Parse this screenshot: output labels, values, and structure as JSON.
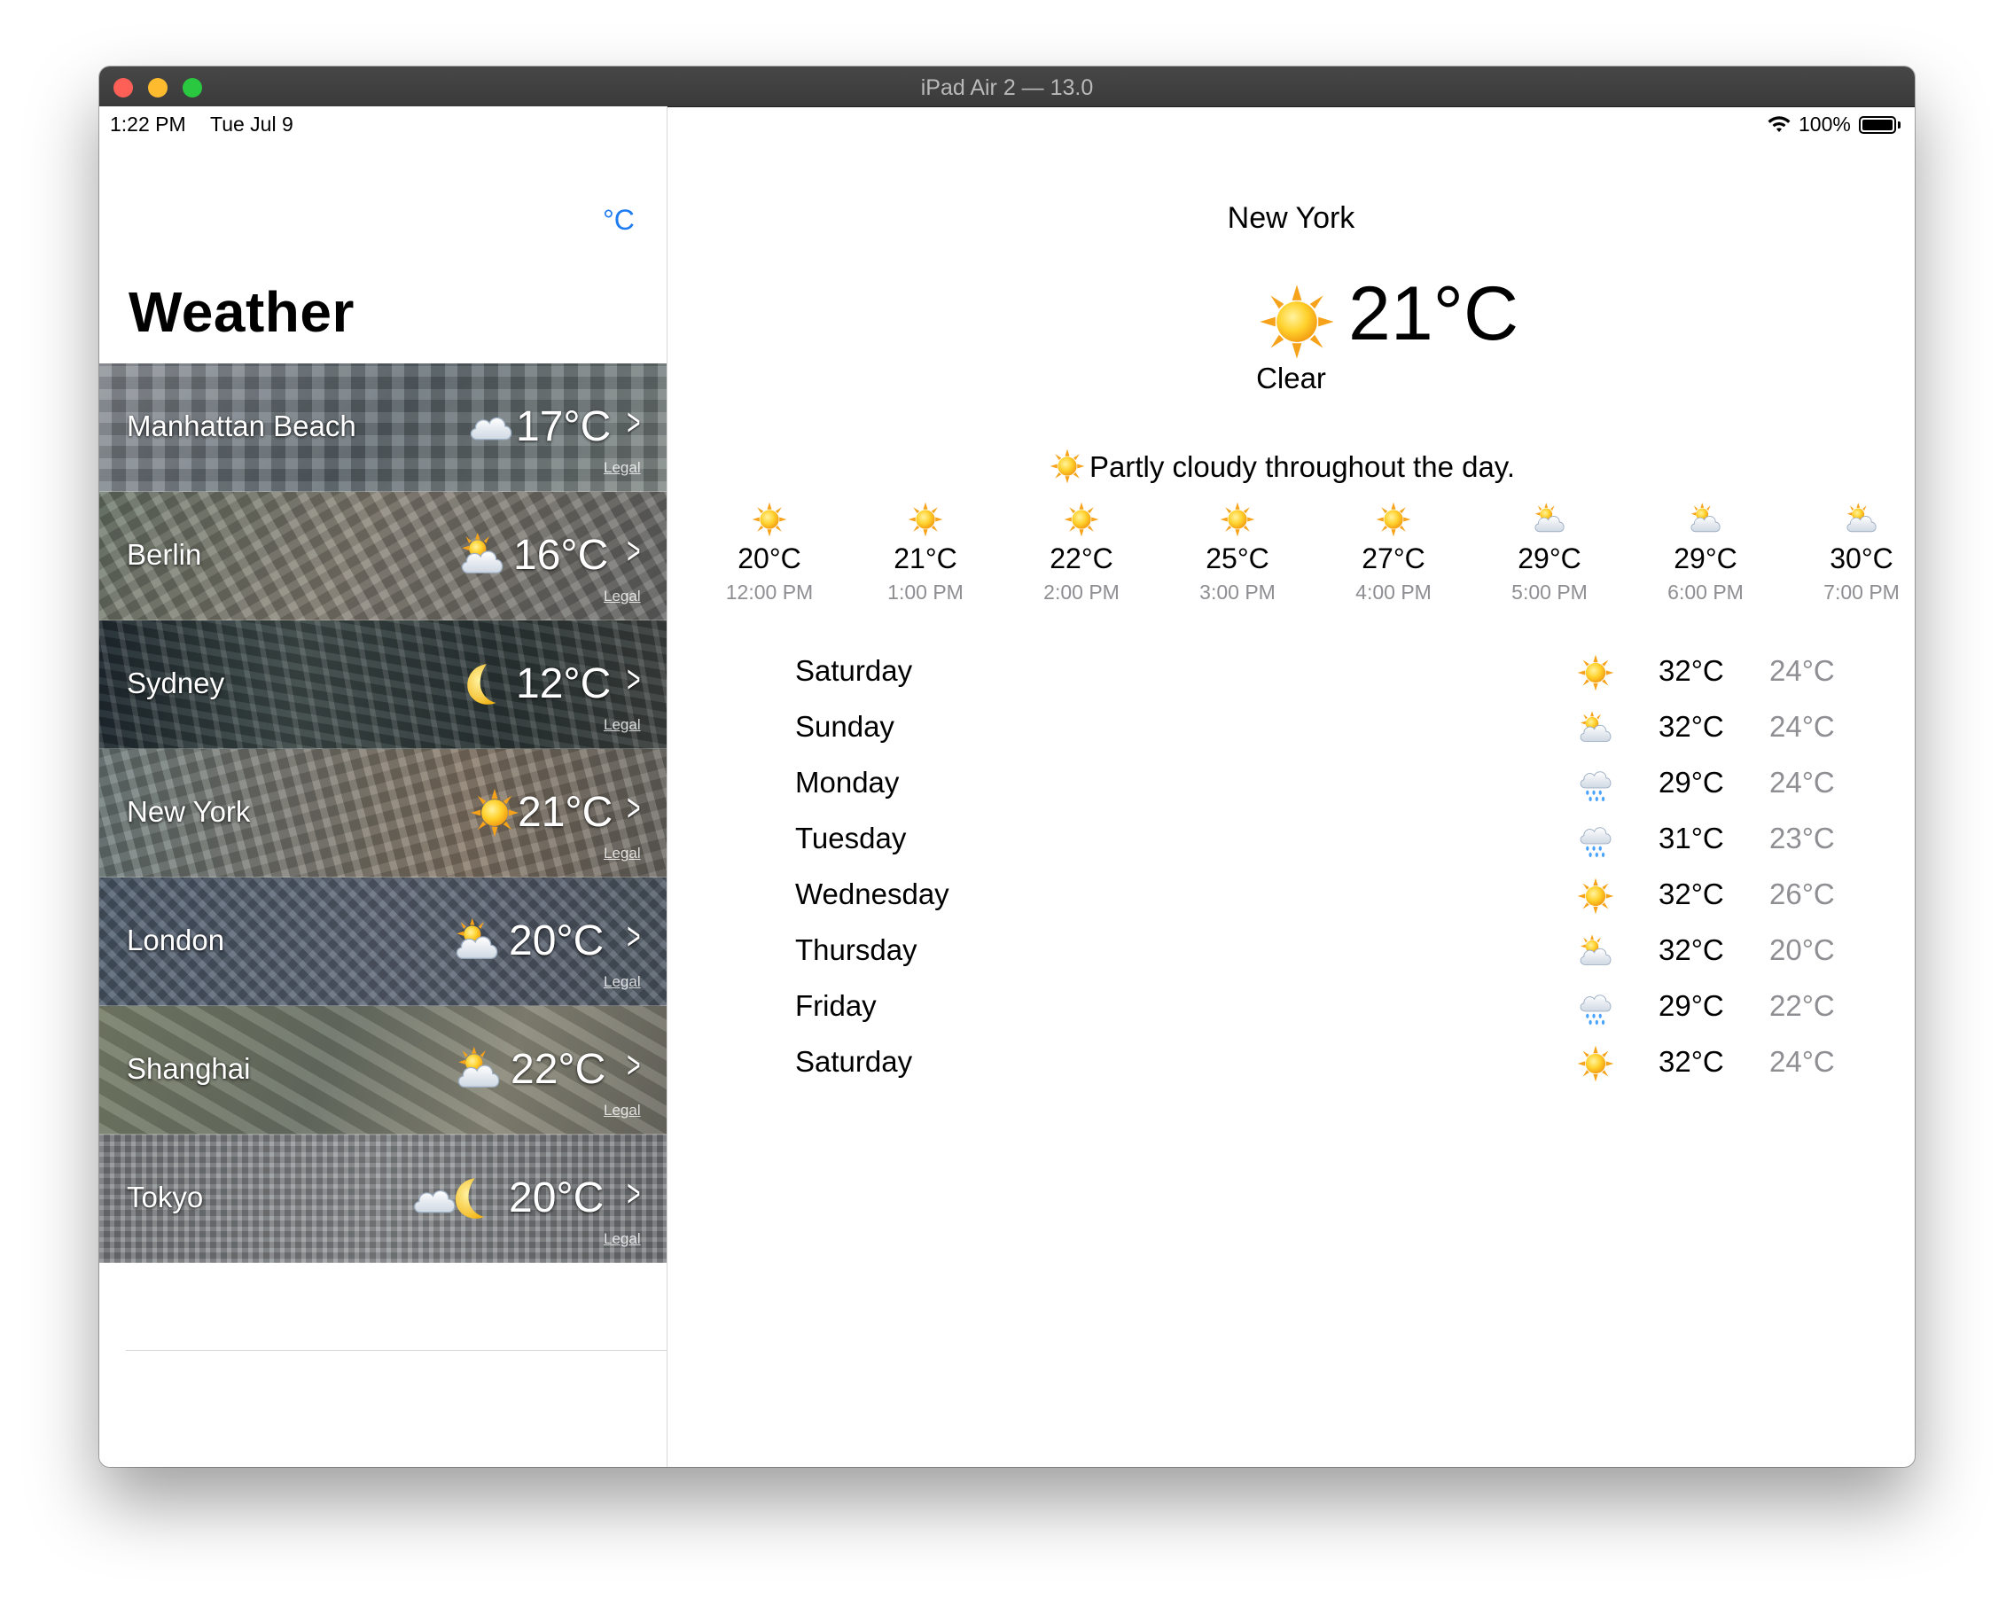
{
  "window": {
    "title": "iPad Air 2 — 13.0"
  },
  "status_bar": {
    "time": "1:22 PM",
    "date": "Tue Jul 9",
    "battery": "100%"
  },
  "sidebar": {
    "unit_toggle": "°C",
    "title": "Weather",
    "cities": [
      {
        "name": "Manhattan Beach",
        "temp": "17°C",
        "icon": "cloud-icon",
        "legal": "Legal"
      },
      {
        "name": "Berlin",
        "temp": "16°C",
        "icon": "sun-behind-cloud-icon",
        "legal": "Legal"
      },
      {
        "name": "Sydney",
        "temp": "12°C",
        "icon": "moon-icon",
        "legal": "Legal"
      },
      {
        "name": "New York",
        "temp": "21°C",
        "icon": "sun-icon",
        "legal": "Legal"
      },
      {
        "name": "London",
        "temp": "20°C",
        "icon": "sun-behind-cloud-icon",
        "legal": "Legal"
      },
      {
        "name": "Shanghai",
        "temp": "22°C",
        "icon": "sun-behind-cloud-icon",
        "legal": "Legal"
      },
      {
        "name": "Tokyo",
        "temp": "20°C",
        "icon": "cloud-moon-icon",
        "legal": "Legal"
      }
    ]
  },
  "detail": {
    "city": "New York",
    "current_temp": "21°C",
    "condition": "Clear",
    "summary": "Partly cloudy throughout the day.",
    "hourly": [
      {
        "temp": "20°C",
        "time": "12:00 PM",
        "icon": "sun-icon"
      },
      {
        "temp": "21°C",
        "time": "1:00 PM",
        "icon": "sun-icon"
      },
      {
        "temp": "22°C",
        "time": "2:00 PM",
        "icon": "sun-icon"
      },
      {
        "temp": "25°C",
        "time": "3:00 PM",
        "icon": "sun-icon"
      },
      {
        "temp": "27°C",
        "time": "4:00 PM",
        "icon": "sun-icon"
      },
      {
        "temp": "29°C",
        "time": "5:00 PM",
        "icon": "sun-behind-cloud-icon"
      },
      {
        "temp": "29°C",
        "time": "6:00 PM",
        "icon": "sun-behind-cloud-icon"
      },
      {
        "temp": "30°C",
        "time": "7:00 PM",
        "icon": "sun-behind-cloud-icon"
      }
    ],
    "daily": [
      {
        "day": "Saturday",
        "high": "32°C",
        "low": "24°C",
        "icon": "sun-icon"
      },
      {
        "day": "Sunday",
        "high": "32°C",
        "low": "24°C",
        "icon": "sun-behind-cloud-icon"
      },
      {
        "day": "Monday",
        "high": "29°C",
        "low": "24°C",
        "icon": "rain-cloud-icon"
      },
      {
        "day": "Tuesday",
        "high": "31°C",
        "low": "23°C",
        "icon": "rain-cloud-icon"
      },
      {
        "day": "Wednesday",
        "high": "32°C",
        "low": "26°C",
        "icon": "sun-icon"
      },
      {
        "day": "Thursday",
        "high": "32°C",
        "low": "20°C",
        "icon": "sun-behind-cloud-icon"
      },
      {
        "day": "Friday",
        "high": "29°C",
        "low": "22°C",
        "icon": "rain-cloud-icon"
      },
      {
        "day": "Saturday",
        "high": "32°C",
        "low": "24°C",
        "icon": "sun-icon"
      }
    ]
  },
  "colors": {
    "accent": "#1e7cf2",
    "secondary_text": "#8e8e93"
  }
}
